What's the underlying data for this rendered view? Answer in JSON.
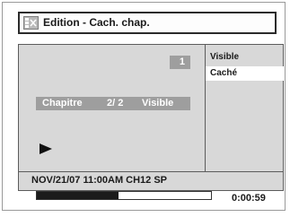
{
  "header": {
    "title": "Edition - Cach. chap.",
    "icon": "edit-icon"
  },
  "preview": {
    "number_badge": "1",
    "chapter_label": "Chapitre",
    "chapter_index": "2/ 2",
    "chapter_status": "Visible",
    "play_icon": "play-icon"
  },
  "options": [
    {
      "label": "Visible",
      "selected": false
    },
    {
      "label": "Caché",
      "selected": true
    }
  ],
  "status": {
    "recording_info": "NOV/21/07 11:00AM CH12 SP",
    "progress_fraction": 0.47,
    "elapsed": "0:00:59"
  }
}
